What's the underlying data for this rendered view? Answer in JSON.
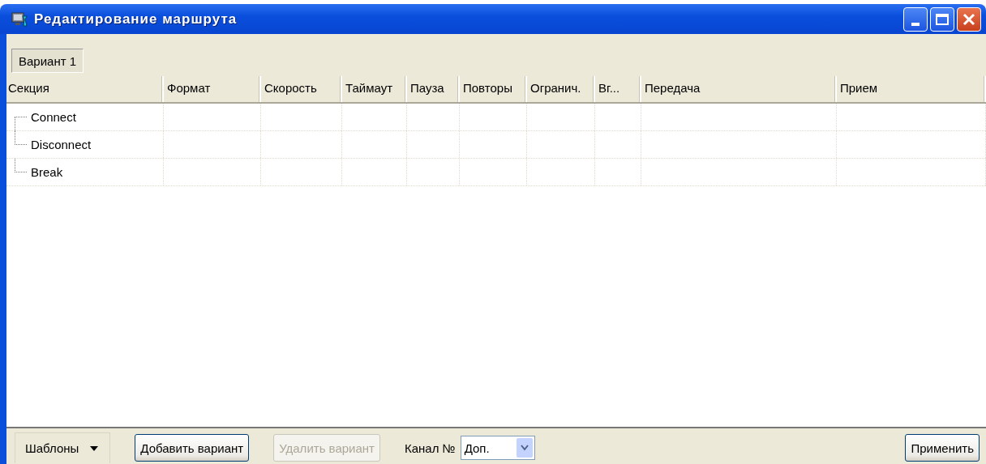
{
  "window": {
    "title": "Редактирование маршрута"
  },
  "tabs": [
    {
      "label": "Вариант 1",
      "selected": true
    }
  ],
  "table": {
    "columns": [
      "Секция",
      "Формат",
      "Скорость",
      "Таймаут",
      "Пауза",
      "Повторы",
      "Огранич.",
      "Вг...",
      "Передача",
      "Прием"
    ],
    "rows": [
      {
        "section": "Connect"
      },
      {
        "section": "Disconnect"
      },
      {
        "section": "Break"
      }
    ]
  },
  "toolbar": [
    {
      "kind": "menu",
      "label": "Шаблоны",
      "disabled": false
    },
    {
      "kind": "button",
      "label": "Добавить вариант",
      "disabled": false
    },
    {
      "kind": "button",
      "label": "Удалить вариант",
      "disabled": true
    },
    {
      "kind": "label",
      "label": "Канал №"
    },
    {
      "kind": "combo",
      "value": "Доп."
    },
    {
      "kind": "spacer"
    },
    {
      "kind": "button",
      "label": "Применить",
      "disabled": false
    }
  ]
}
